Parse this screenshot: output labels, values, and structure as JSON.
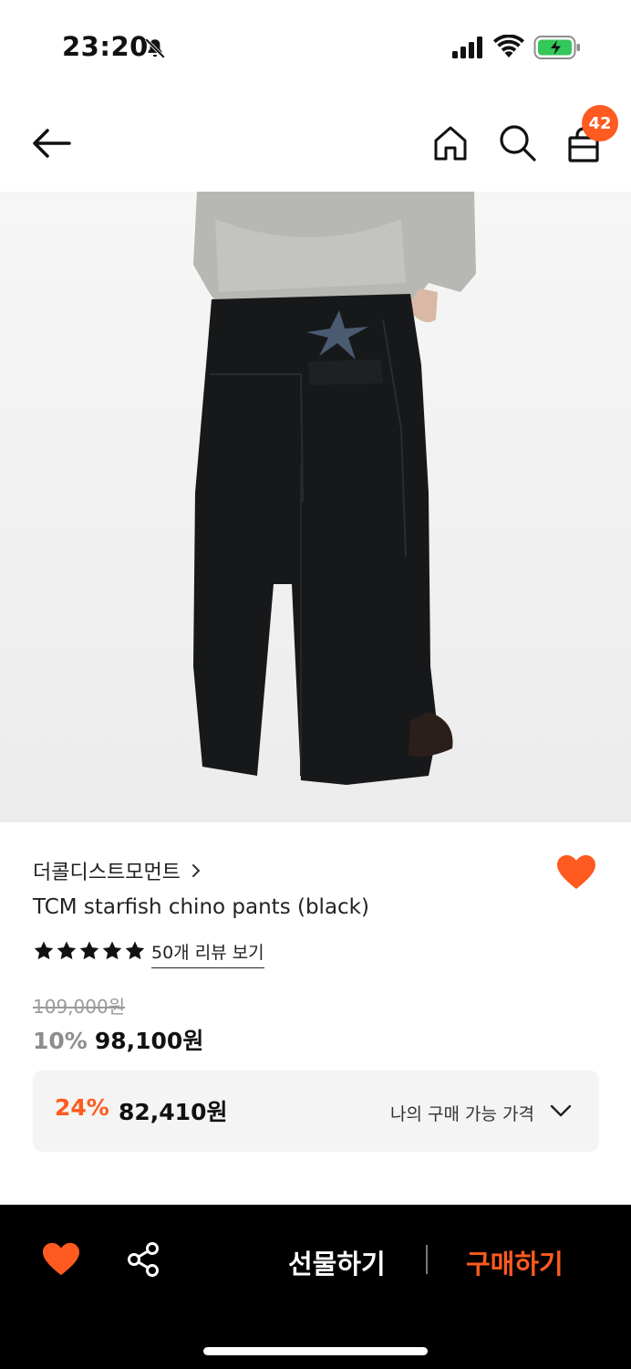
{
  "status_bar": {
    "time": "23:20",
    "icons": [
      "bell-off-icon",
      "signal-icon",
      "wifi-icon",
      "battery-charging-icon"
    ]
  },
  "nav": {
    "icons": [
      "back-arrow-icon",
      "home-icon",
      "search-icon",
      "shopping-bag-icon"
    ],
    "cart_count": "42"
  },
  "product": {
    "image": "product-photo",
    "brand": "더콜디스트모먼트",
    "title": "TCM starfish chino pants (black)",
    "rating_stars": 5,
    "review_link": "50개 리뷰 보기",
    "original_price": "109,000원",
    "discount_rate": "10%",
    "sale_price": "98,100원"
  },
  "my_price": {
    "rate": "24%",
    "price": "82,410원",
    "label": "나의 구매 가능 가격"
  },
  "bottom_bar": {
    "gift_label": "선물하기",
    "buy_label": "구매하기"
  },
  "colors": {
    "accent": "#ff5a1f",
    "bottom_bar_bg": "#000000",
    "price_box_bg": "#f4f4f4"
  }
}
